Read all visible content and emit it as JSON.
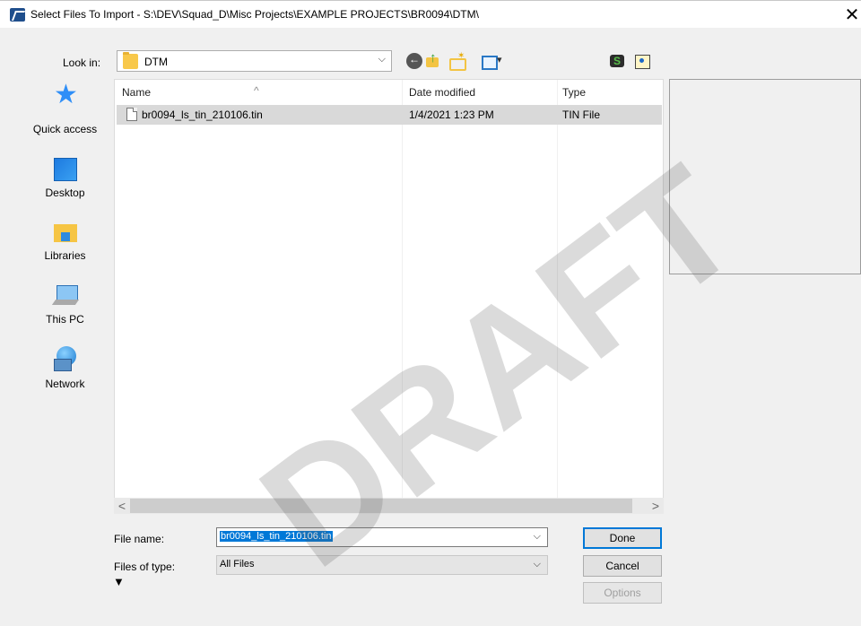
{
  "window": {
    "title": "Select Files To Import - S:\\DEV\\Squad_D\\Misc Projects\\EXAMPLE PROJECTS\\BR0094\\DTM\\",
    "close_symbol": "✕"
  },
  "lookin": {
    "label": "Look in:",
    "value": "DTM",
    "arrow": "⌵"
  },
  "places": [
    {
      "label": "Quick access",
      "icon": "quick-access-icon"
    },
    {
      "label": "Desktop",
      "icon": "desktop-icon"
    },
    {
      "label": "Libraries",
      "icon": "libraries-icon"
    },
    {
      "label": "This PC",
      "icon": "this-pc-icon"
    },
    {
      "label": "Network",
      "icon": "network-icon"
    }
  ],
  "file_list": {
    "columns": [
      "Name",
      "Date modified",
      "Type"
    ],
    "sort_indicator": "^",
    "rows": [
      {
        "name": "br0094_ls_tin_210106.tin",
        "date_modified": "1/4/2021 1:23 PM",
        "type": "TIN File"
      }
    ]
  },
  "scrollbar": {
    "left_arrow": "<",
    "right_arrow": ">"
  },
  "form": {
    "file_name_label": "File name:",
    "file_name_value": "br0094_ls_tin_210106.tin",
    "files_of_type_label": "Files of type:",
    "files_of_type_value": "All Files",
    "dropdown_arrow": "⌵",
    "expand_symbol": "▼"
  },
  "buttons": {
    "done": "Done",
    "cancel": "Cancel",
    "options": "Options"
  },
  "watermark": "DRAFT"
}
